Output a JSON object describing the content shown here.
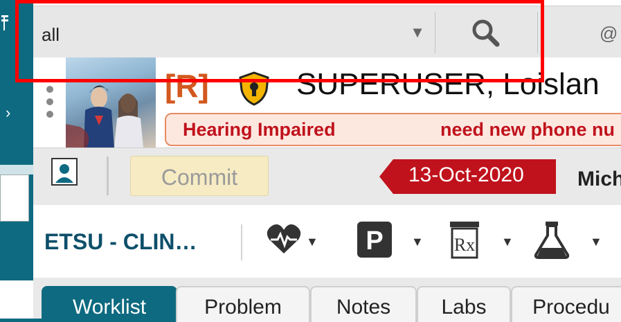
{
  "search": {
    "value": "all",
    "dropdown_icon": "caret-down-icon",
    "search_icon": "magnifier-icon",
    "at_label": "@"
  },
  "patient": {
    "restriction_tag": "[R]",
    "shield_icon": "shield-lock-icon",
    "name": "SUPERUSER, Loislan",
    "alerts": [
      "Hearing Impaired",
      "need new phone nu"
    ]
  },
  "toolbar": {
    "commit_label": "Commit",
    "date": "13-Oct-2020",
    "user": "Mich"
  },
  "iconbar": {
    "location": "ETSU - CLIN…",
    "icons": [
      "heart-monitor-icon",
      "parking-icon",
      "prescription-icon",
      "lab-flask-icon"
    ]
  },
  "tabs": [
    {
      "label": "Worklist",
      "active": true
    },
    {
      "label": "Problem",
      "active": false
    },
    {
      "label": "Notes",
      "active": false
    },
    {
      "label": "Labs",
      "active": false
    },
    {
      "label": "Procedu",
      "active": false
    }
  ],
  "colors": {
    "brand_teal": "#0e6a80",
    "alert_red": "#c0121c",
    "restriction_orange": "#d2581f",
    "date_tag_red": "#c0121c",
    "annotation_red": "#ff0000"
  }
}
